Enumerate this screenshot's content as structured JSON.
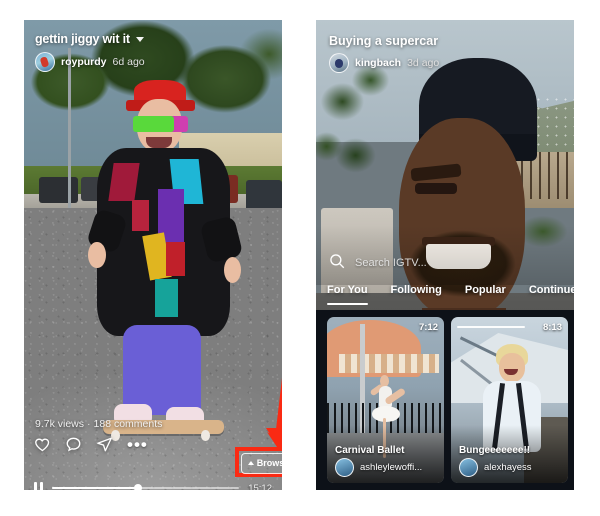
{
  "page": {
    "background": "#ffffff",
    "accent_highlight": "#fa2a13"
  },
  "left_screen": {
    "name": "igtv-video-player",
    "video_title": "gettin jiggy wit it",
    "caret_icon": "chevron-down-icon",
    "author": {
      "username": "roypurdy",
      "time_ago": "6d ago",
      "avatar_icon": "avatar"
    },
    "stats": {
      "views": "9.7k views",
      "separator": "·",
      "comments": "188 comments"
    },
    "actions": [
      {
        "name": "like-icon",
        "label": "Like"
      },
      {
        "name": "comment-icon",
        "label": "Comment"
      },
      {
        "name": "share-icon",
        "label": "Share"
      },
      {
        "name": "more-options-icon",
        "label": "•••"
      }
    ],
    "browse_button": {
      "label": "Browse",
      "chevron_icon": "chevron-up-icon",
      "highlighted": true,
      "highlight_color": "#fa2a13"
    },
    "arrow_annotation": "red-arrow-down",
    "player": {
      "pause_icon": "pause-icon",
      "progress_percent": 46,
      "time_remaining": "15:12"
    }
  },
  "right_screen": {
    "name": "igtv-browse-overlay",
    "video_title": "Buying a supercar",
    "author": {
      "username": "kingbach",
      "time_ago": "3d ago",
      "avatar_icon": "avatar"
    },
    "search": {
      "icon": "search-icon",
      "placeholder": "Search IGTV..."
    },
    "profile_button": {
      "name": "profile-avatar-button",
      "highlighted": true,
      "highlight_color": "#fa2a13"
    },
    "sparkle_icon": "sparkle-icon",
    "arrow_annotation": "red-arrow-down",
    "tabs": [
      {
        "label": "For You",
        "active": true
      },
      {
        "label": "Following",
        "active": false
      },
      {
        "label": "Popular",
        "active": false
      },
      {
        "label": "Continue W",
        "active": false
      }
    ],
    "cards": [
      {
        "title": "Carnival Ballet",
        "username": "ashleylewoffi...",
        "duration": "7:12",
        "has_progress_bar": false
      },
      {
        "title": "Bungeeeeeee!!",
        "username": "alexhayess",
        "duration": "8:13",
        "has_progress_bar": true
      },
      {
        "title": "",
        "username": "",
        "duration": "",
        "has_progress_bar": false
      }
    ]
  }
}
